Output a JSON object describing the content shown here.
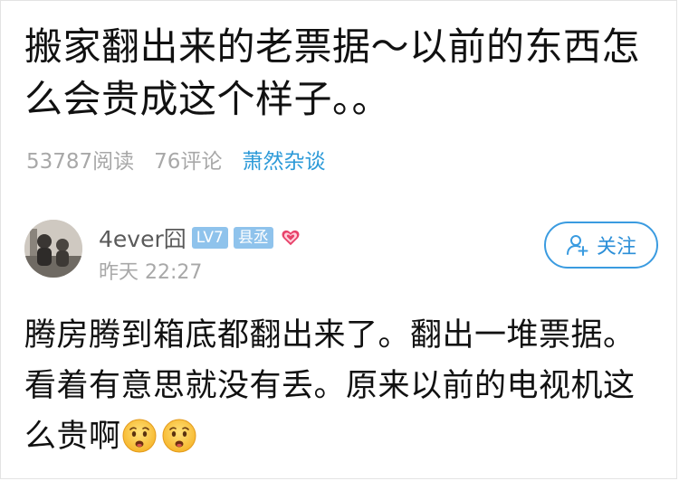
{
  "post": {
    "title": "搬家翻出来的老票据～以前的东西怎么会贵成这个样子。。",
    "read_count": "53787阅读",
    "comment_count": "76评论",
    "channel": "萧然杂谈"
  },
  "author": {
    "name": "4ever囧",
    "level_badge": "LV7",
    "rank_badge": "县丞",
    "time": "昨天 22:27",
    "avatar_icon": "user-avatar-photo",
    "heart_icon": "heart-icon"
  },
  "follow": {
    "label": "关注",
    "icon": "add-user-icon"
  },
  "content": {
    "text": "腾房腾到箱底都翻出来了。翻出一堆票据。看着有意思就没有丢。原来以前的电视机这么贵啊",
    "emoji_icon": "worried-face-emoji"
  },
  "colors": {
    "accent": "#2c9ad8",
    "badge": "#8fc3ec",
    "muted": "#a8a8a8",
    "heart": "#e8426a"
  }
}
